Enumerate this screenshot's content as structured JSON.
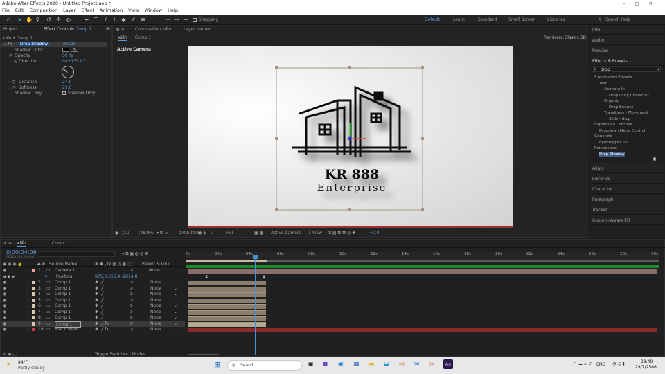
{
  "window": {
    "title": "Adobe After Effects 2020 - Untitled Project.aep *"
  },
  "menu": [
    "File",
    "Edit",
    "Composition",
    "Layer",
    "Effect",
    "Animation",
    "View",
    "Window",
    "Help"
  ],
  "toolbar": {
    "snapping": "Snapping",
    "workspaces": [
      "Default",
      "Learn",
      "Standard",
      "Small Screen",
      "Libraries"
    ],
    "search": "Search Help"
  },
  "project_tabs": {
    "project": "Project",
    "effect_controls": "Effect Controls",
    "effect_controls_target": "Comp 1",
    "comp_path": "ĸiển • Comp 1"
  },
  "effect_controls": {
    "effect_name": "Drop Shadow",
    "reset": "Reset",
    "rows": [
      {
        "label": "Shadow Color",
        "value": ""
      },
      {
        "label": "Opacity",
        "value": "50 %"
      },
      {
        "label": "Direction",
        "value": "0x+135.0°"
      },
      {
        "label": "Distance",
        "value": "24.0"
      },
      {
        "label": "Softness",
        "value": "29.0"
      },
      {
        "label": "Shadow Only",
        "value": "Shadow Only"
      }
    ]
  },
  "composition": {
    "tab": "Composition ĸiển",
    "layer_tab": "Layer (none)",
    "sub_tab_1": "ĸiển",
    "sub_tab_2": "Comp 1",
    "renderer_label": "Renderer:",
    "renderer": "Classic 3D",
    "active_camera": "Active Camera",
    "logo_line1": "KR 888",
    "logo_line2": "Enterprise",
    "footer": {
      "zoom": "(48.9%)",
      "time": "0:00:04:09",
      "quality": "Full",
      "view": "Active Camera",
      "views": "1 View",
      "exposure": "+0.0"
    }
  },
  "right_panel": {
    "top_sections": [
      "Info",
      "Audio",
      "Preview"
    ],
    "effects_title": "Effects & Presets",
    "search_value": "drop",
    "tree": [
      {
        "label": "* Animation Presets",
        "indent": 0
      },
      {
        "label": "Text",
        "indent": 1
      },
      {
        "label": "Animate In",
        "indent": 2
      },
      {
        "label": "Drop In By Character",
        "indent": 3
      },
      {
        "label": "Organic",
        "indent": 2
      },
      {
        "label": "Drop Bounce",
        "indent": 3
      },
      {
        "label": "Transitions - Movement",
        "indent": 2
      },
      {
        "label": "Slide - drop",
        "indent": 3
      },
      {
        "label": "Expression Controls",
        "indent": 0
      },
      {
        "label": "Dropdown Menu Control",
        "indent": 1
      },
      {
        "label": "Generate",
        "indent": 0
      },
      {
        "label": "Eyedropper Fill",
        "indent": 1
      },
      {
        "label": "Perspective",
        "indent": 0
      },
      {
        "label": "Drop Shadow",
        "indent": 1
      }
    ],
    "bottom_sections": [
      "Align",
      "Libraries",
      "Character",
      "Paragraph",
      "Tracker",
      "Content-Aware Fill"
    ]
  },
  "timeline": {
    "tab1": "ĸiển",
    "tab2": "Comp 1",
    "timecode": "0:00:04:09",
    "frames": "00129 (30.00 fps)",
    "col_source": "Source Name",
    "col_parent": "Parent & Link",
    "ruler": [
      "0s",
      "02s",
      "04s",
      "06s",
      "08s",
      "10s",
      "12s",
      "14s",
      "16s",
      "18s",
      "20s",
      "22s",
      "24s",
      "26s",
      "28s",
      "30s"
    ],
    "position_label": "Position",
    "position_value": "875.0,556.4,-2814.8",
    "layers": [
      {
        "num": "1",
        "name": "Camera 1",
        "parent": "None",
        "color": "#e8a0a0"
      },
      {
        "num": "2",
        "name": "Comp 1",
        "parent": "None",
        "color": "#d8c9a8"
      },
      {
        "num": "3",
        "name": "Comp 1",
        "parent": "None",
        "color": "#d8c9a8"
      },
      {
        "num": "4",
        "name": "Comp 1",
        "parent": "None",
        "color": "#d8c9a8"
      },
      {
        "num": "5",
        "name": "Comp 1",
        "parent": "None",
        "color": "#d8c9a8"
      },
      {
        "num": "6",
        "name": "Comp 1",
        "parent": "None",
        "color": "#d8c9a8"
      },
      {
        "num": "7",
        "name": "Comp 1",
        "parent": "None",
        "color": "#d8c9a8"
      },
      {
        "num": "8",
        "name": "Comp 1",
        "parent": "None",
        "color": "#d8c9a8"
      },
      {
        "num": "9",
        "name": "Comp 1",
        "parent": "None",
        "color": "#d8c9a8"
      },
      {
        "num": "10",
        "name": "Black Solid 1",
        "parent": "None",
        "color": "#c94040"
      }
    ],
    "toggle": "Toggle Switches / Modes"
  },
  "taskbar": {
    "temp": "84°F",
    "weather": "Partly cloudy",
    "search": "Search",
    "lang": "ENG",
    "time": "23:49",
    "date": "29/7/2566"
  }
}
